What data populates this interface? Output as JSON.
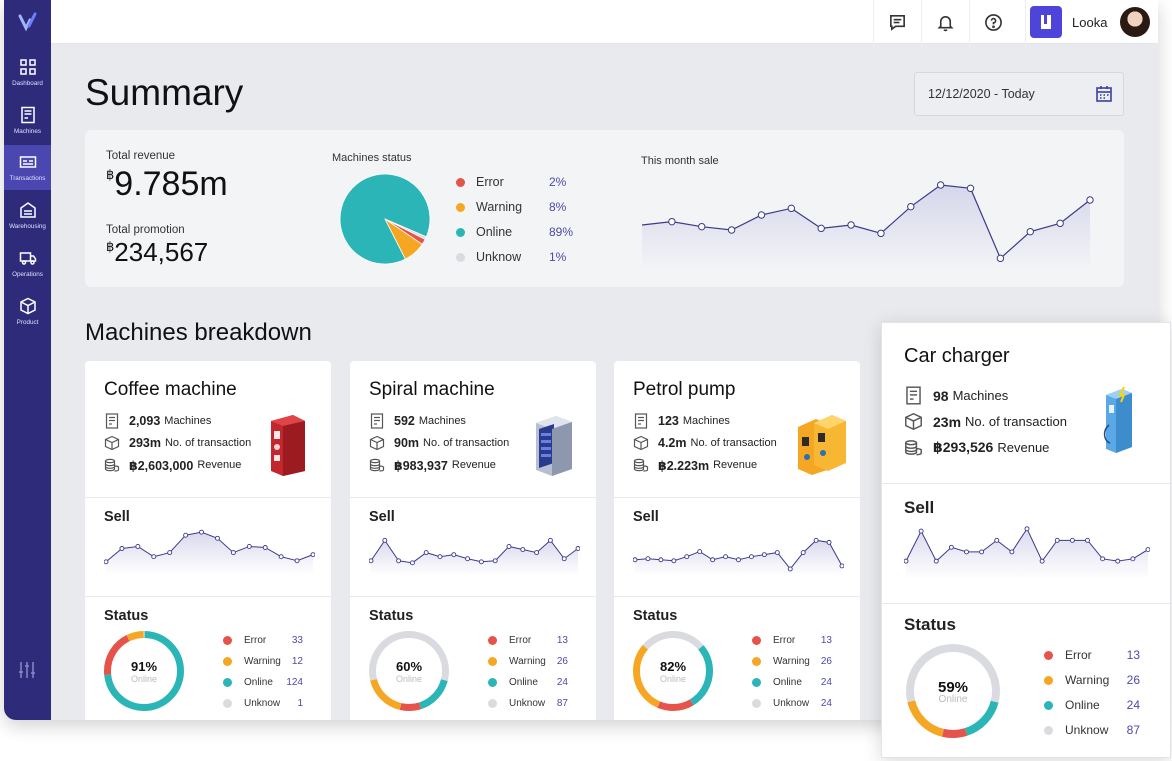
{
  "sidebar": {
    "items": [
      {
        "label": "Dashboard",
        "icon": "grid-icon"
      },
      {
        "label": "Machines",
        "icon": "machine-icon"
      },
      {
        "label": "Transactions",
        "icon": "transaction-icon",
        "active": true
      },
      {
        "label": "Warehousing",
        "icon": "warehouse-icon"
      },
      {
        "label": "Operations",
        "icon": "truck-icon"
      },
      {
        "label": "Product",
        "icon": "box-icon"
      }
    ]
  },
  "topbar": {
    "user_name": "Looka"
  },
  "summary": {
    "title": "Summary",
    "date_range": "12/12/2020 - Today",
    "total_revenue_label": "Total revenue",
    "total_revenue_currency": "฿",
    "total_revenue": "9.785m",
    "total_promotion_label": "Total promotion",
    "total_promotion_currency": "฿",
    "total_promotion": "234,567",
    "machines_status_label": "Machines status",
    "this_month_sale_label": "This month sale"
  },
  "machines_status": [
    {
      "label": "Error",
      "value": "2%",
      "pct": 2,
      "color": "#e5534b"
    },
    {
      "label": "Warning",
      "value": "8%",
      "pct": 8,
      "color": "#f5a623"
    },
    {
      "label": "Online",
      "value": "89%",
      "pct": 89,
      "color": "#2bb5b7"
    },
    {
      "label": "Unknow",
      "value": "1%",
      "pct": 1,
      "color": "#dadbe0"
    }
  ],
  "month_sale": [
    27,
    29,
    26,
    24,
    33,
    37,
    25,
    27,
    22,
    38,
    51,
    49,
    7,
    23,
    28,
    42
  ],
  "breakdown_title": "Machines breakdown",
  "labels": {
    "machines": "Machines",
    "transactions": "No. of transaction",
    "revenue": "Revenue",
    "sell": "Sell",
    "status": "Status",
    "online": "Online"
  },
  "status_labels": [
    "Error",
    "Warning",
    "Online",
    "Unknow"
  ],
  "status_colors": [
    "#e5534b",
    "#f5a623",
    "#2bb5b7",
    "#dadbe0"
  ],
  "cards": [
    {
      "title": "Coffee machine",
      "machines": "2,093",
      "transactions": "293m",
      "revenue": "฿2,603,000",
      "pct": "91%",
      "counts": [
        "33",
        "12",
        "124",
        "1"
      ],
      "sell": [
        9,
        22,
        24,
        14,
        18,
        35,
        38,
        32,
        18,
        24,
        23,
        14,
        10,
        16
      ]
    },
    {
      "title": "Spiral machine",
      "machines": "592",
      "transactions": "90m",
      "revenue": "฿983,937",
      "pct": "60%",
      "counts": [
        "13",
        "26",
        "24",
        "87"
      ],
      "sell": [
        10,
        30,
        10,
        8,
        18,
        14,
        16,
        12,
        9,
        10,
        24,
        21,
        18,
        30,
        12,
        22
      ]
    },
    {
      "title": "Petrol pump",
      "machines": "123",
      "transactions": "4.2m",
      "revenue": "฿2.223m",
      "pct": "82%",
      "counts": [
        "13",
        "26",
        "24",
        "24"
      ],
      "sell": [
        11,
        12,
        11,
        10,
        14,
        19,
        11,
        14,
        11,
        14,
        16,
        18,
        2,
        18,
        30,
        28,
        5
      ]
    },
    {
      "title": "Car charger",
      "machines": "98",
      "transactions": "23m",
      "revenue": "฿293,526",
      "pct": "59%",
      "counts": [
        "13",
        "26",
        "24",
        "87"
      ],
      "sell": [
        12,
        38,
        12,
        24,
        20,
        20,
        30,
        20,
        40,
        12,
        30,
        30,
        30,
        14,
        12,
        14,
        22
      ]
    }
  ]
}
